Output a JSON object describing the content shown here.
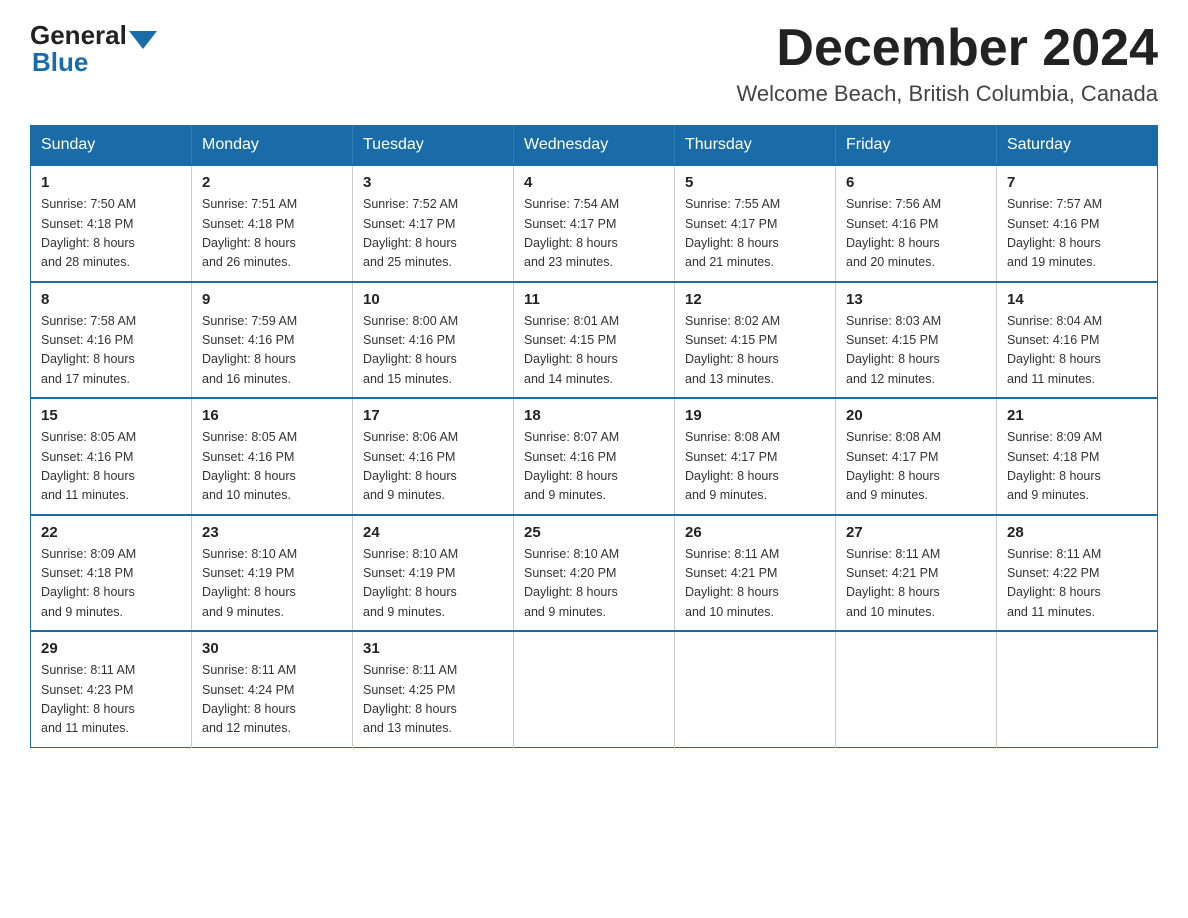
{
  "logo": {
    "general": "General",
    "blue": "Blue"
  },
  "header": {
    "month": "December 2024",
    "location": "Welcome Beach, British Columbia, Canada"
  },
  "weekdays": [
    "Sunday",
    "Monday",
    "Tuesday",
    "Wednesday",
    "Thursday",
    "Friday",
    "Saturday"
  ],
  "weeks": [
    [
      {
        "day": "1",
        "info": "Sunrise: 7:50 AM\nSunset: 4:18 PM\nDaylight: 8 hours\nand 28 minutes."
      },
      {
        "day": "2",
        "info": "Sunrise: 7:51 AM\nSunset: 4:18 PM\nDaylight: 8 hours\nand 26 minutes."
      },
      {
        "day": "3",
        "info": "Sunrise: 7:52 AM\nSunset: 4:17 PM\nDaylight: 8 hours\nand 25 minutes."
      },
      {
        "day": "4",
        "info": "Sunrise: 7:54 AM\nSunset: 4:17 PM\nDaylight: 8 hours\nand 23 minutes."
      },
      {
        "day": "5",
        "info": "Sunrise: 7:55 AM\nSunset: 4:17 PM\nDaylight: 8 hours\nand 21 minutes."
      },
      {
        "day": "6",
        "info": "Sunrise: 7:56 AM\nSunset: 4:16 PM\nDaylight: 8 hours\nand 20 minutes."
      },
      {
        "day": "7",
        "info": "Sunrise: 7:57 AM\nSunset: 4:16 PM\nDaylight: 8 hours\nand 19 minutes."
      }
    ],
    [
      {
        "day": "8",
        "info": "Sunrise: 7:58 AM\nSunset: 4:16 PM\nDaylight: 8 hours\nand 17 minutes."
      },
      {
        "day": "9",
        "info": "Sunrise: 7:59 AM\nSunset: 4:16 PM\nDaylight: 8 hours\nand 16 minutes."
      },
      {
        "day": "10",
        "info": "Sunrise: 8:00 AM\nSunset: 4:16 PM\nDaylight: 8 hours\nand 15 minutes."
      },
      {
        "day": "11",
        "info": "Sunrise: 8:01 AM\nSunset: 4:15 PM\nDaylight: 8 hours\nand 14 minutes."
      },
      {
        "day": "12",
        "info": "Sunrise: 8:02 AM\nSunset: 4:15 PM\nDaylight: 8 hours\nand 13 minutes."
      },
      {
        "day": "13",
        "info": "Sunrise: 8:03 AM\nSunset: 4:15 PM\nDaylight: 8 hours\nand 12 minutes."
      },
      {
        "day": "14",
        "info": "Sunrise: 8:04 AM\nSunset: 4:16 PM\nDaylight: 8 hours\nand 11 minutes."
      }
    ],
    [
      {
        "day": "15",
        "info": "Sunrise: 8:05 AM\nSunset: 4:16 PM\nDaylight: 8 hours\nand 11 minutes."
      },
      {
        "day": "16",
        "info": "Sunrise: 8:05 AM\nSunset: 4:16 PM\nDaylight: 8 hours\nand 10 minutes."
      },
      {
        "day": "17",
        "info": "Sunrise: 8:06 AM\nSunset: 4:16 PM\nDaylight: 8 hours\nand 9 minutes."
      },
      {
        "day": "18",
        "info": "Sunrise: 8:07 AM\nSunset: 4:16 PM\nDaylight: 8 hours\nand 9 minutes."
      },
      {
        "day": "19",
        "info": "Sunrise: 8:08 AM\nSunset: 4:17 PM\nDaylight: 8 hours\nand 9 minutes."
      },
      {
        "day": "20",
        "info": "Sunrise: 8:08 AM\nSunset: 4:17 PM\nDaylight: 8 hours\nand 9 minutes."
      },
      {
        "day": "21",
        "info": "Sunrise: 8:09 AM\nSunset: 4:18 PM\nDaylight: 8 hours\nand 9 minutes."
      }
    ],
    [
      {
        "day": "22",
        "info": "Sunrise: 8:09 AM\nSunset: 4:18 PM\nDaylight: 8 hours\nand 9 minutes."
      },
      {
        "day": "23",
        "info": "Sunrise: 8:10 AM\nSunset: 4:19 PM\nDaylight: 8 hours\nand 9 minutes."
      },
      {
        "day": "24",
        "info": "Sunrise: 8:10 AM\nSunset: 4:19 PM\nDaylight: 8 hours\nand 9 minutes."
      },
      {
        "day": "25",
        "info": "Sunrise: 8:10 AM\nSunset: 4:20 PM\nDaylight: 8 hours\nand 9 minutes."
      },
      {
        "day": "26",
        "info": "Sunrise: 8:11 AM\nSunset: 4:21 PM\nDaylight: 8 hours\nand 10 minutes."
      },
      {
        "day": "27",
        "info": "Sunrise: 8:11 AM\nSunset: 4:21 PM\nDaylight: 8 hours\nand 10 minutes."
      },
      {
        "day": "28",
        "info": "Sunrise: 8:11 AM\nSunset: 4:22 PM\nDaylight: 8 hours\nand 11 minutes."
      }
    ],
    [
      {
        "day": "29",
        "info": "Sunrise: 8:11 AM\nSunset: 4:23 PM\nDaylight: 8 hours\nand 11 minutes."
      },
      {
        "day": "30",
        "info": "Sunrise: 8:11 AM\nSunset: 4:24 PM\nDaylight: 8 hours\nand 12 minutes."
      },
      {
        "day": "31",
        "info": "Sunrise: 8:11 AM\nSunset: 4:25 PM\nDaylight: 8 hours\nand 13 minutes."
      },
      null,
      null,
      null,
      null
    ]
  ]
}
